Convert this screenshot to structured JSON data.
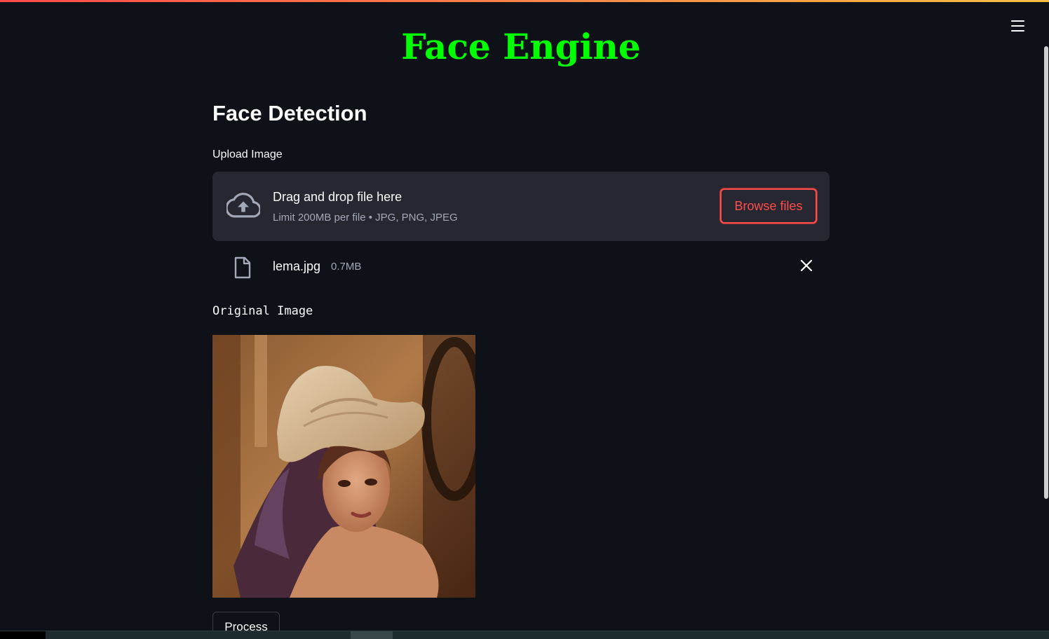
{
  "header": {
    "title": "Face Engine"
  },
  "menu": {
    "icon": "hamburger-menu-icon"
  },
  "main": {
    "heading": "Face Detection",
    "uploader": {
      "label": "Upload Image",
      "drop_text": "Drag and drop file here",
      "limit_text": "Limit 200MB per file • JPG, PNG, JPEG",
      "browse_label": "Browse files",
      "icon": "cloud-upload-icon"
    },
    "uploaded_file": {
      "name": "lema.jpg",
      "size": "0.7MB",
      "icon": "file-icon",
      "remove_icon": "close-icon"
    },
    "image_caption": "Original Image",
    "process_label": "Process"
  },
  "colors": {
    "background": "#0e1117",
    "title": "#00ff00",
    "accent": "#ff4b4b",
    "panel": "#262730",
    "muted_text": "#a3a8b8"
  }
}
